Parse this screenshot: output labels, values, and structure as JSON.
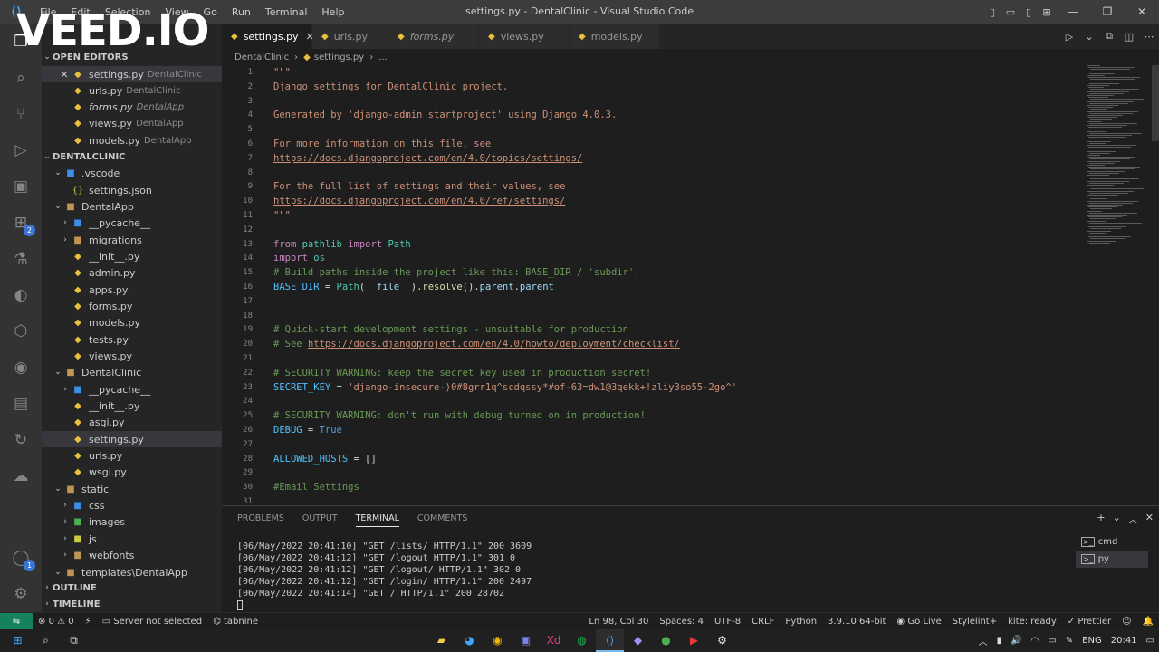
{
  "watermark": "VEED.IO",
  "window": {
    "title": "settings.py - DentalClinic - Visual Studio Code",
    "menu": [
      "File",
      "Edit",
      "Selection",
      "View",
      "Go",
      "Run",
      "Terminal",
      "Help"
    ]
  },
  "sidebar": {
    "open_editors_header": "OPEN EDITORS",
    "open_editors": [
      {
        "name": "settings.py",
        "desc": "DentalClinic"
      },
      {
        "name": "urls.py",
        "desc": "DentalClinic"
      },
      {
        "name": "forms.py",
        "desc": "DentalApp"
      },
      {
        "name": "views.py",
        "desc": "DentalApp"
      },
      {
        "name": "models.py",
        "desc": "DentalApp"
      }
    ],
    "project_header": "DENTALCLINIC",
    "tree": [
      {
        "name": ".vscode"
      },
      {
        "name": "settings.json"
      },
      {
        "name": "DentalApp"
      },
      {
        "name": "__pycache__"
      },
      {
        "name": "migrations"
      },
      {
        "name": "__init__.py"
      },
      {
        "name": "admin.py"
      },
      {
        "name": "apps.py"
      },
      {
        "name": "forms.py"
      },
      {
        "name": "models.py"
      },
      {
        "name": "tests.py"
      },
      {
        "name": "views.py"
      },
      {
        "name": "DentalClinic"
      },
      {
        "name": "__pycache__"
      },
      {
        "name": "__init__.py"
      },
      {
        "name": "asgi.py"
      },
      {
        "name": "settings.py"
      },
      {
        "name": "urls.py"
      },
      {
        "name": "wsgi.py"
      },
      {
        "name": "static"
      },
      {
        "name": "css"
      },
      {
        "name": "images"
      },
      {
        "name": "js"
      },
      {
        "name": "webfonts"
      },
      {
        "name": "templates\\DentalApp"
      }
    ],
    "outline": "OUTLINE",
    "timeline": "TIMELINE"
  },
  "tabs": [
    {
      "label": "settings.py"
    },
    {
      "label": "urls.py"
    },
    {
      "label": "forms.py"
    },
    {
      "label": "views.py"
    },
    {
      "label": "models.py"
    }
  ],
  "breadcrumb": [
    "DentalClinic",
    "settings.py",
    "..."
  ],
  "editor": {
    "lines": [
      {
        "n": "1",
        "parts": [
          [
            "c-str",
            "\"\"\""
          ]
        ]
      },
      {
        "n": "2",
        "parts": [
          [
            "c-str",
            "Django settings for DentalClinic project."
          ]
        ]
      },
      {
        "n": "3",
        "parts": []
      },
      {
        "n": "4",
        "parts": [
          [
            "c-str",
            "Generated by 'django-admin startproject' using Django 4.0.3."
          ]
        ]
      },
      {
        "n": "5",
        "parts": []
      },
      {
        "n": "6",
        "parts": [
          [
            "c-str",
            "For more information on this file, see"
          ]
        ]
      },
      {
        "n": "7",
        "parts": [
          [
            "c-link",
            "https://docs.djangoproject.com/en/4.0/topics/settings/"
          ]
        ]
      },
      {
        "n": "8",
        "parts": []
      },
      {
        "n": "9",
        "parts": [
          [
            "c-str",
            "For the full list of settings and their values, see"
          ]
        ]
      },
      {
        "n": "10",
        "parts": [
          [
            "c-link",
            "https://docs.djangoproject.com/en/4.0/ref/settings/"
          ]
        ]
      },
      {
        "n": "11",
        "parts": [
          [
            "c-str",
            "\"\"\""
          ]
        ]
      },
      {
        "n": "12",
        "parts": []
      },
      {
        "n": "13",
        "parts": [
          [
            "c-kw",
            "from "
          ],
          [
            "c-cls",
            "pathlib "
          ],
          [
            "c-kw",
            "import "
          ],
          [
            "c-cls",
            "Path"
          ]
        ]
      },
      {
        "n": "14",
        "parts": [
          [
            "c-kw",
            "import "
          ],
          [
            "c-cls",
            "os"
          ]
        ]
      },
      {
        "n": "15",
        "parts": [
          [
            "c-cm",
            "# Build paths inside the project like this: BASE_DIR / 'subdir'."
          ]
        ]
      },
      {
        "n": "16",
        "parts": [
          [
            "c-const",
            "BASE_DIR"
          ],
          [
            "c-txt",
            " = "
          ],
          [
            "c-cls",
            "Path"
          ],
          [
            "c-txt",
            "("
          ],
          [
            "c-var",
            "__file__"
          ],
          [
            "c-txt",
            ")."
          ],
          [
            "c-fn",
            "resolve"
          ],
          [
            "c-txt",
            "()."
          ],
          [
            "c-var",
            "parent"
          ],
          [
            "c-txt",
            "."
          ],
          [
            "c-var",
            "parent"
          ]
        ]
      },
      {
        "n": "17",
        "parts": []
      },
      {
        "n": "18",
        "parts": []
      },
      {
        "n": "19",
        "parts": [
          [
            "c-cm",
            "# Quick-start development settings - unsuitable for production"
          ]
        ]
      },
      {
        "n": "20",
        "parts": [
          [
            "c-cm",
            "# See "
          ],
          [
            "c-link",
            "https://docs.djangoproject.com/en/4.0/howto/deployment/checklist/"
          ]
        ]
      },
      {
        "n": "21",
        "parts": []
      },
      {
        "n": "22",
        "parts": [
          [
            "c-cm",
            "# SECURITY WARNING: keep the secret key used in production secret!"
          ]
        ]
      },
      {
        "n": "23",
        "parts": [
          [
            "c-const",
            "SECRET_KEY"
          ],
          [
            "c-txt",
            " = "
          ],
          [
            "c-str",
            "'django-insecure-)0#8grr1q^scdqssy*#of-63=dw1@3qekk+!zliy3so55-2go^'"
          ]
        ]
      },
      {
        "n": "24",
        "parts": []
      },
      {
        "n": "25",
        "parts": [
          [
            "c-cm",
            "# SECURITY WARNING: don't run with debug turned on in production!"
          ]
        ]
      },
      {
        "n": "26",
        "parts": [
          [
            "c-const",
            "DEBUG"
          ],
          [
            "c-txt",
            " = "
          ],
          [
            "c-bool",
            "True"
          ]
        ]
      },
      {
        "n": "27",
        "parts": []
      },
      {
        "n": "28",
        "parts": [
          [
            "c-const",
            "ALLOWED_HOSTS"
          ],
          [
            "c-txt",
            " = []"
          ]
        ]
      },
      {
        "n": "29",
        "parts": []
      },
      {
        "n": "30",
        "parts": [
          [
            "c-cm",
            "#Email Settings"
          ]
        ]
      },
      {
        "n": "31",
        "parts": []
      }
    ]
  },
  "panel": {
    "tabs": [
      "PROBLEMS",
      "OUTPUT",
      "TERMINAL",
      "COMMENTS"
    ],
    "active_tab": "TERMINAL",
    "terminal_lines": [
      "[06/May/2022 20:41:10] \"GET /lists/ HTTP/1.1\" 200 3609",
      "[06/May/2022 20:41:12] \"GET /logout HTTP/1.1\" 301 0",
      "[06/May/2022 20:41:12] \"GET /logout/ HTTP/1.1\" 302 0",
      "[06/May/2022 20:41:12] \"GET /login/ HTTP/1.1\" 200 2497",
      "[06/May/2022 20:41:14] \"GET / HTTP/1.1\" 200 28702"
    ],
    "terminals": [
      "cmd",
      "py"
    ]
  },
  "status": {
    "errors": "0",
    "warnings": "0",
    "server": "Server not selected",
    "tabnine": "tabnine",
    "position": "Ln 98, Col 30",
    "spaces": "Spaces: 4",
    "encoding": "UTF-8",
    "eol": "CRLF",
    "language": "Python",
    "interpreter": "3.9.10 64-bit",
    "golive": "Go Live",
    "stylelint": "Stylelint+",
    "kite": "kite: ready",
    "prettier": "Prettier"
  },
  "taskbar": {
    "lang": "ENG",
    "time": "20:41"
  },
  "colors": {
    "accent": "#007acc",
    "remote": "#16825d",
    "python": "#e8c23d"
  }
}
